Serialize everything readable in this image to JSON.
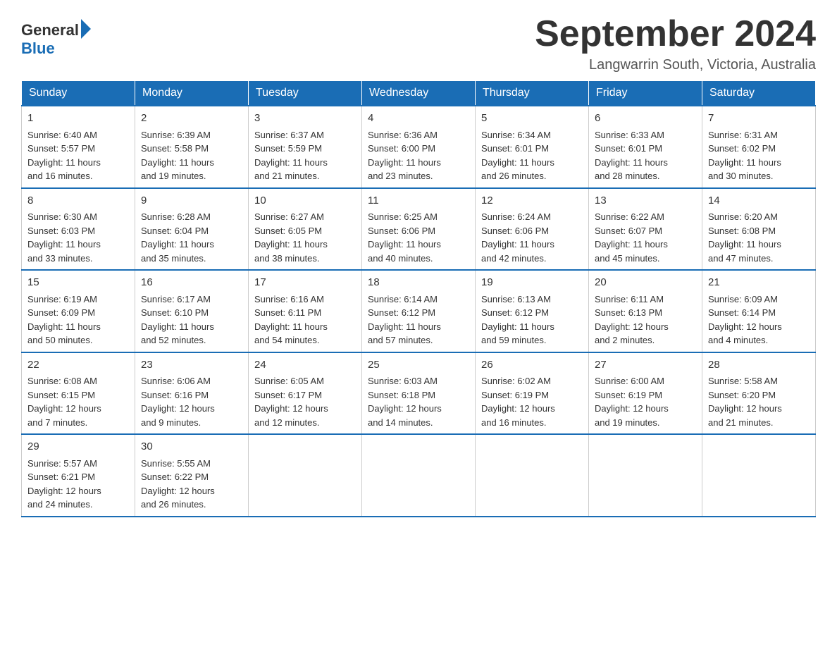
{
  "header": {
    "logo_general": "General",
    "logo_blue": "Blue",
    "title": "September 2024",
    "location": "Langwarrin South, Victoria, Australia"
  },
  "days_of_week": [
    "Sunday",
    "Monday",
    "Tuesday",
    "Wednesday",
    "Thursday",
    "Friday",
    "Saturday"
  ],
  "weeks": [
    [
      {
        "day": "1",
        "sunrise": "6:40 AM",
        "sunset": "5:57 PM",
        "daylight": "11 hours and 16 minutes."
      },
      {
        "day": "2",
        "sunrise": "6:39 AM",
        "sunset": "5:58 PM",
        "daylight": "11 hours and 19 minutes."
      },
      {
        "day": "3",
        "sunrise": "6:37 AM",
        "sunset": "5:59 PM",
        "daylight": "11 hours and 21 minutes."
      },
      {
        "day": "4",
        "sunrise": "6:36 AM",
        "sunset": "6:00 PM",
        "daylight": "11 hours and 23 minutes."
      },
      {
        "day": "5",
        "sunrise": "6:34 AM",
        "sunset": "6:01 PM",
        "daylight": "11 hours and 26 minutes."
      },
      {
        "day": "6",
        "sunrise": "6:33 AM",
        "sunset": "6:01 PM",
        "daylight": "11 hours and 28 minutes."
      },
      {
        "day": "7",
        "sunrise": "6:31 AM",
        "sunset": "6:02 PM",
        "daylight": "11 hours and 30 minutes."
      }
    ],
    [
      {
        "day": "8",
        "sunrise": "6:30 AM",
        "sunset": "6:03 PM",
        "daylight": "11 hours and 33 minutes."
      },
      {
        "day": "9",
        "sunrise": "6:28 AM",
        "sunset": "6:04 PM",
        "daylight": "11 hours and 35 minutes."
      },
      {
        "day": "10",
        "sunrise": "6:27 AM",
        "sunset": "6:05 PM",
        "daylight": "11 hours and 38 minutes."
      },
      {
        "day": "11",
        "sunrise": "6:25 AM",
        "sunset": "6:06 PM",
        "daylight": "11 hours and 40 minutes."
      },
      {
        "day": "12",
        "sunrise": "6:24 AM",
        "sunset": "6:06 PM",
        "daylight": "11 hours and 42 minutes."
      },
      {
        "day": "13",
        "sunrise": "6:22 AM",
        "sunset": "6:07 PM",
        "daylight": "11 hours and 45 minutes."
      },
      {
        "day": "14",
        "sunrise": "6:20 AM",
        "sunset": "6:08 PM",
        "daylight": "11 hours and 47 minutes."
      }
    ],
    [
      {
        "day": "15",
        "sunrise": "6:19 AM",
        "sunset": "6:09 PM",
        "daylight": "11 hours and 50 minutes."
      },
      {
        "day": "16",
        "sunrise": "6:17 AM",
        "sunset": "6:10 PM",
        "daylight": "11 hours and 52 minutes."
      },
      {
        "day": "17",
        "sunrise": "6:16 AM",
        "sunset": "6:11 PM",
        "daylight": "11 hours and 54 minutes."
      },
      {
        "day": "18",
        "sunrise": "6:14 AM",
        "sunset": "6:12 PM",
        "daylight": "11 hours and 57 minutes."
      },
      {
        "day": "19",
        "sunrise": "6:13 AM",
        "sunset": "6:12 PM",
        "daylight": "11 hours and 59 minutes."
      },
      {
        "day": "20",
        "sunrise": "6:11 AM",
        "sunset": "6:13 PM",
        "daylight": "12 hours and 2 minutes."
      },
      {
        "day": "21",
        "sunrise": "6:09 AM",
        "sunset": "6:14 PM",
        "daylight": "12 hours and 4 minutes."
      }
    ],
    [
      {
        "day": "22",
        "sunrise": "6:08 AM",
        "sunset": "6:15 PM",
        "daylight": "12 hours and 7 minutes."
      },
      {
        "day": "23",
        "sunrise": "6:06 AM",
        "sunset": "6:16 PM",
        "daylight": "12 hours and 9 minutes."
      },
      {
        "day": "24",
        "sunrise": "6:05 AM",
        "sunset": "6:17 PM",
        "daylight": "12 hours and 12 minutes."
      },
      {
        "day": "25",
        "sunrise": "6:03 AM",
        "sunset": "6:18 PM",
        "daylight": "12 hours and 14 minutes."
      },
      {
        "day": "26",
        "sunrise": "6:02 AM",
        "sunset": "6:19 PM",
        "daylight": "12 hours and 16 minutes."
      },
      {
        "day": "27",
        "sunrise": "6:00 AM",
        "sunset": "6:19 PM",
        "daylight": "12 hours and 19 minutes."
      },
      {
        "day": "28",
        "sunrise": "5:58 AM",
        "sunset": "6:20 PM",
        "daylight": "12 hours and 21 minutes."
      }
    ],
    [
      {
        "day": "29",
        "sunrise": "5:57 AM",
        "sunset": "6:21 PM",
        "daylight": "12 hours and 24 minutes."
      },
      {
        "day": "30",
        "sunrise": "5:55 AM",
        "sunset": "6:22 PM",
        "daylight": "12 hours and 26 minutes."
      },
      null,
      null,
      null,
      null,
      null
    ]
  ],
  "labels": {
    "sunrise": "Sunrise:",
    "sunset": "Sunset:",
    "daylight": "Daylight:"
  }
}
